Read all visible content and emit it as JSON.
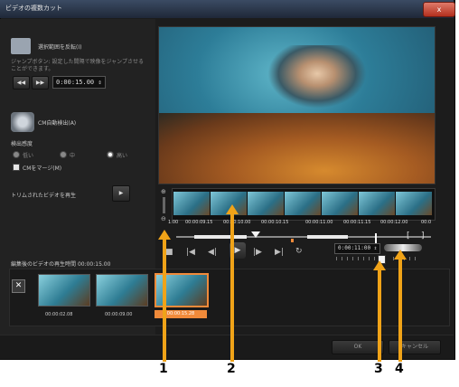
{
  "window": {
    "title": "ビデオの複数カット",
    "close_label": "x"
  },
  "left_panel": {
    "reverse_label": "選択範囲を反転(I)",
    "jump_desc": "ジャンプボタン: 設定した間隔で映像をジャンプさせる\nことができます。",
    "jump_interval": "0:00:15.00",
    "cm_detect_label": "CM自動検出(A)",
    "sensitivity_label": "検出感度",
    "sensitivity_options": [
      "低い",
      "中",
      "高い"
    ],
    "sensitivity_selected": "高い",
    "merge_cm_label": "CMをマージ(M)",
    "play_trimmed_label": "トリムされたビデオを再生",
    "edited_duration_label": "編集後のビデオの再生時間",
    "edited_duration_value": "00:00:15.00"
  },
  "timeline": {
    "tick_labels": [
      "1:00",
      "00:00:09.15",
      "00:00:10.00",
      "00:00:10.15",
      "00:00:11.00",
      "00:00:11.15",
      "00:00:12.00",
      "00:0"
    ]
  },
  "playback": {
    "timecode": "0:00:11:00",
    "mark_in": "[",
    "mark_out": "]"
  },
  "clips": [
    {
      "time": "00:00:02.08",
      "selected": false
    },
    {
      "time": "00:00:09.00",
      "selected": false
    },
    {
      "time": "00:00:15.28",
      "selected": true
    }
  ],
  "buttons": {
    "ok": "OK",
    "cancel": "キャンセル"
  },
  "callouts": [
    "1",
    "2",
    "3",
    "4"
  ],
  "colors": {
    "callout": "#f0a318",
    "selection": "#f08a3a"
  }
}
